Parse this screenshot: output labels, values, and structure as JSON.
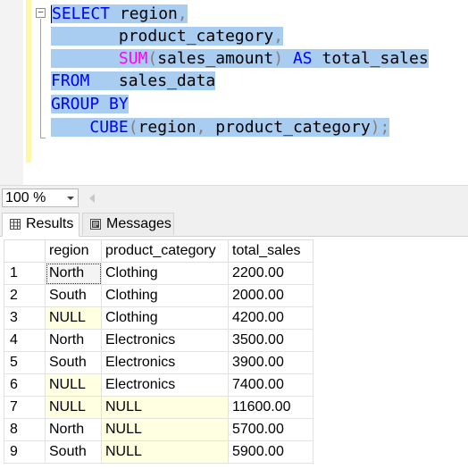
{
  "editor": {
    "lines": [
      [
        {
          "t": "SELECT",
          "c": "kw"
        },
        {
          "t": " region",
          "c": ""
        },
        {
          "t": ",",
          "c": "gray"
        }
      ],
      [
        {
          "t": "       product_category",
          "c": ""
        },
        {
          "t": ",",
          "c": "gray"
        }
      ],
      [
        {
          "t": "       ",
          "c": ""
        },
        {
          "t": "SUM",
          "c": "fn"
        },
        {
          "t": "(",
          "c": "gray"
        },
        {
          "t": "sales_amount",
          "c": ""
        },
        {
          "t": ")",
          "c": "gray"
        },
        {
          "t": " ",
          "c": ""
        },
        {
          "t": "AS",
          "c": "kw"
        },
        {
          "t": " total_sales",
          "c": ""
        }
      ],
      [
        {
          "t": "FROM",
          "c": "kw"
        },
        {
          "t": "   sales_data",
          "c": ""
        }
      ],
      [
        {
          "t": "GROUP",
          "c": "kw"
        },
        {
          "t": " ",
          "c": ""
        },
        {
          "t": "BY",
          "c": "kw"
        }
      ],
      [
        {
          "t": "    ",
          "c": ""
        },
        {
          "t": "CUBE",
          "c": "kw"
        },
        {
          "t": "(",
          "c": "gray"
        },
        {
          "t": "region",
          "c": ""
        },
        {
          "t": ",",
          "c": "gray"
        },
        {
          "t": " product_category",
          "c": ""
        },
        {
          "t": ");",
          "c": "gray"
        }
      ]
    ],
    "fold_symbol": "−"
  },
  "zoom": {
    "value": "100 %"
  },
  "tabs": {
    "results_label": "Results",
    "messages_label": "Messages"
  },
  "grid": {
    "columns": [
      "",
      "region",
      "product_category",
      "total_sales"
    ],
    "rows": [
      {
        "n": "1",
        "region": "North",
        "category": "Clothing",
        "total": "2200.00"
      },
      {
        "n": "2",
        "region": "South",
        "category": "Clothing",
        "total": "2000.00"
      },
      {
        "n": "3",
        "region": "NULL",
        "category": "Clothing",
        "total": "4200.00"
      },
      {
        "n": "4",
        "region": "North",
        "category": "Electronics",
        "total": "3500.00"
      },
      {
        "n": "5",
        "region": "South",
        "category": "Electronics",
        "total": "3900.00"
      },
      {
        "n": "6",
        "region": "NULL",
        "category": "Electronics",
        "total": "7400.00"
      },
      {
        "n": "7",
        "region": "NULL",
        "category": "NULL",
        "total": "11600.00"
      },
      {
        "n": "8",
        "region": "North",
        "category": "NULL",
        "total": "5700.00"
      },
      {
        "n": "9",
        "region": "South",
        "category": "NULL",
        "total": "5900.00"
      }
    ]
  },
  "colors": {
    "selection": "#a8cdf0",
    "keyword": "#0000ff",
    "function": "#ff00ff",
    "operator": "#808080",
    "null_cell": "#ffffe1",
    "change_bar": "#fff7a8"
  }
}
